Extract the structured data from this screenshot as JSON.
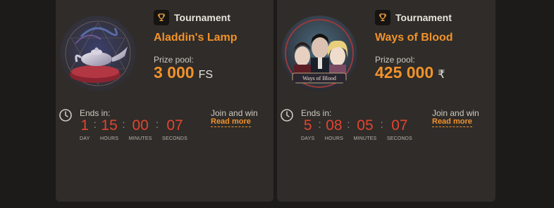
{
  "tournaments": [
    {
      "badge": "Tournament",
      "badge_icon": "trophy-icon",
      "name": "Aladdin's Lamp",
      "prize_label": "Prize pool:",
      "prize_amount": "3 000",
      "prize_unit": "FS",
      "ends_label": "Ends in:",
      "timer": [
        {
          "value": "1",
          "label": "DAY"
        },
        {
          "value": "15",
          "label": "HOURS"
        },
        {
          "value": "00",
          "label": "MINUTES"
        },
        {
          "value": "07",
          "label": "SECONDS"
        }
      ],
      "join_text": "Join and win",
      "read_more": "Read more"
    },
    {
      "badge": "Tournament",
      "badge_icon": "trophy-icon",
      "name": "Ways of Blood",
      "prize_label": "Prize pool:",
      "prize_amount": "425 000",
      "prize_unit": "₹",
      "ends_label": "Ends in:",
      "timer": [
        {
          "value": "5",
          "label": "DAYS"
        },
        {
          "value": "08",
          "label": "HOURS"
        },
        {
          "value": "05",
          "label": "MINUTES"
        },
        {
          "value": "07",
          "label": "SECONDS"
        }
      ],
      "join_text": "Join and win",
      "read_more": "Read more",
      "logo_text": "Ways of Blood"
    }
  ],
  "colors": {
    "accent": "#f1922b",
    "timer": "#e2452f",
    "card": "#2f2c29",
    "background": "#1c1b1a"
  }
}
